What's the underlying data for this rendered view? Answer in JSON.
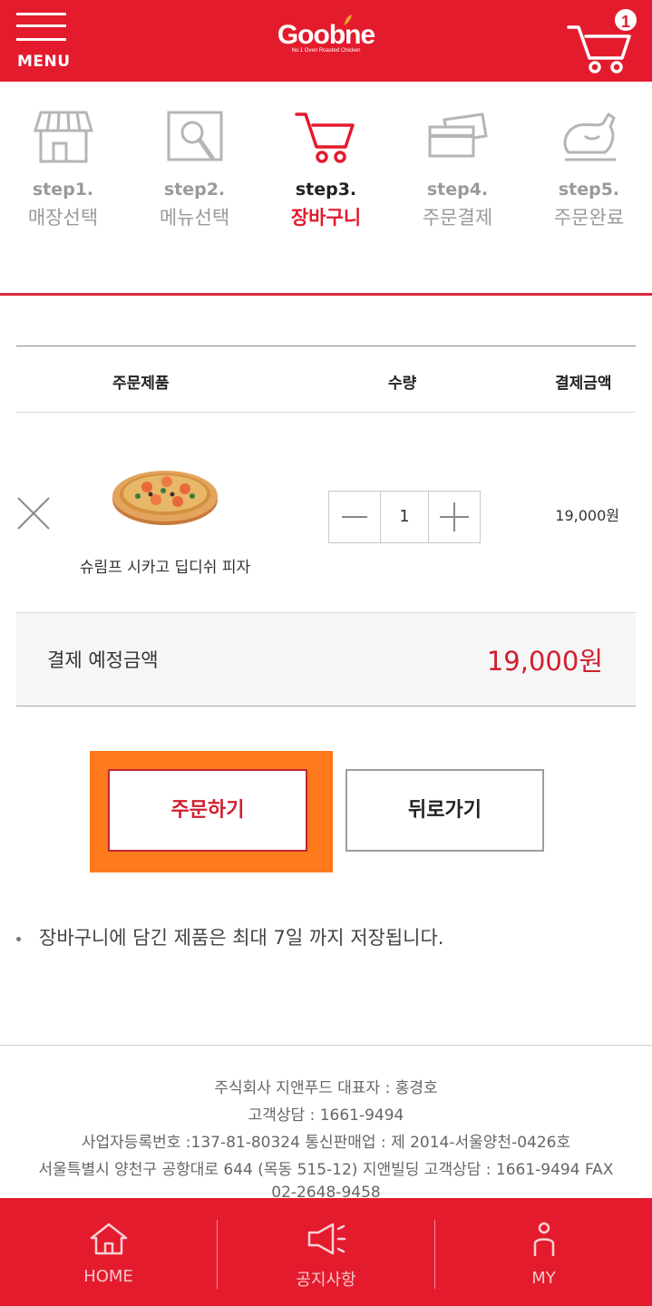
{
  "header": {
    "menu_label": "MENU",
    "logo_text": "Goobne",
    "logo_subtitle": "No.1 Oven Roasted Chicken",
    "cart_count": "1",
    "brand_color": "#e31b2d"
  },
  "steps": [
    {
      "num": "step1.",
      "name": "매장선택",
      "icon": "store-icon",
      "active": false
    },
    {
      "num": "step2.",
      "name": "메뉴선택",
      "icon": "menu-search-icon",
      "active": false
    },
    {
      "num": "step3.",
      "name": "장바구니",
      "icon": "cart-icon",
      "active": true
    },
    {
      "num": "step4.",
      "name": "주문결제",
      "icon": "card-icon",
      "active": false
    },
    {
      "num": "step5.",
      "name": "주문완료",
      "icon": "chicken-icon",
      "active": false
    }
  ],
  "table": {
    "col_product": "주문제품",
    "col_qty": "수량",
    "col_amount": "결제금액"
  },
  "cart_item": {
    "name": "슈림프 시카고 딥디쉬 피자",
    "quantity": "1",
    "price": "19,000원"
  },
  "total": {
    "label": "결제 예정금액",
    "value": "19,000원"
  },
  "buttons": {
    "order": "주문하기",
    "back": "뒤로가기"
  },
  "note": "장바구니에 담긴 제품은 최대 7일 까지 저장됩니다.",
  "footer": {
    "line1": "주식회사 지앤푸드 대표자 : 홍경호",
    "line2": "고객상담 : 1661-9494",
    "line3": "사업자등록번호 :137-81-80324 통신판매업 : 제 2014-서울양천-0426호",
    "line4": "서울특별시 양천구 공항대로 644 (목동 515-12) 지앤빌딩 고객상담 : 1661-9494 FAX",
    "line5": "02-2648-9458"
  },
  "tabbar": {
    "home": "HOME",
    "notice": "공지사항",
    "my": "MY"
  }
}
